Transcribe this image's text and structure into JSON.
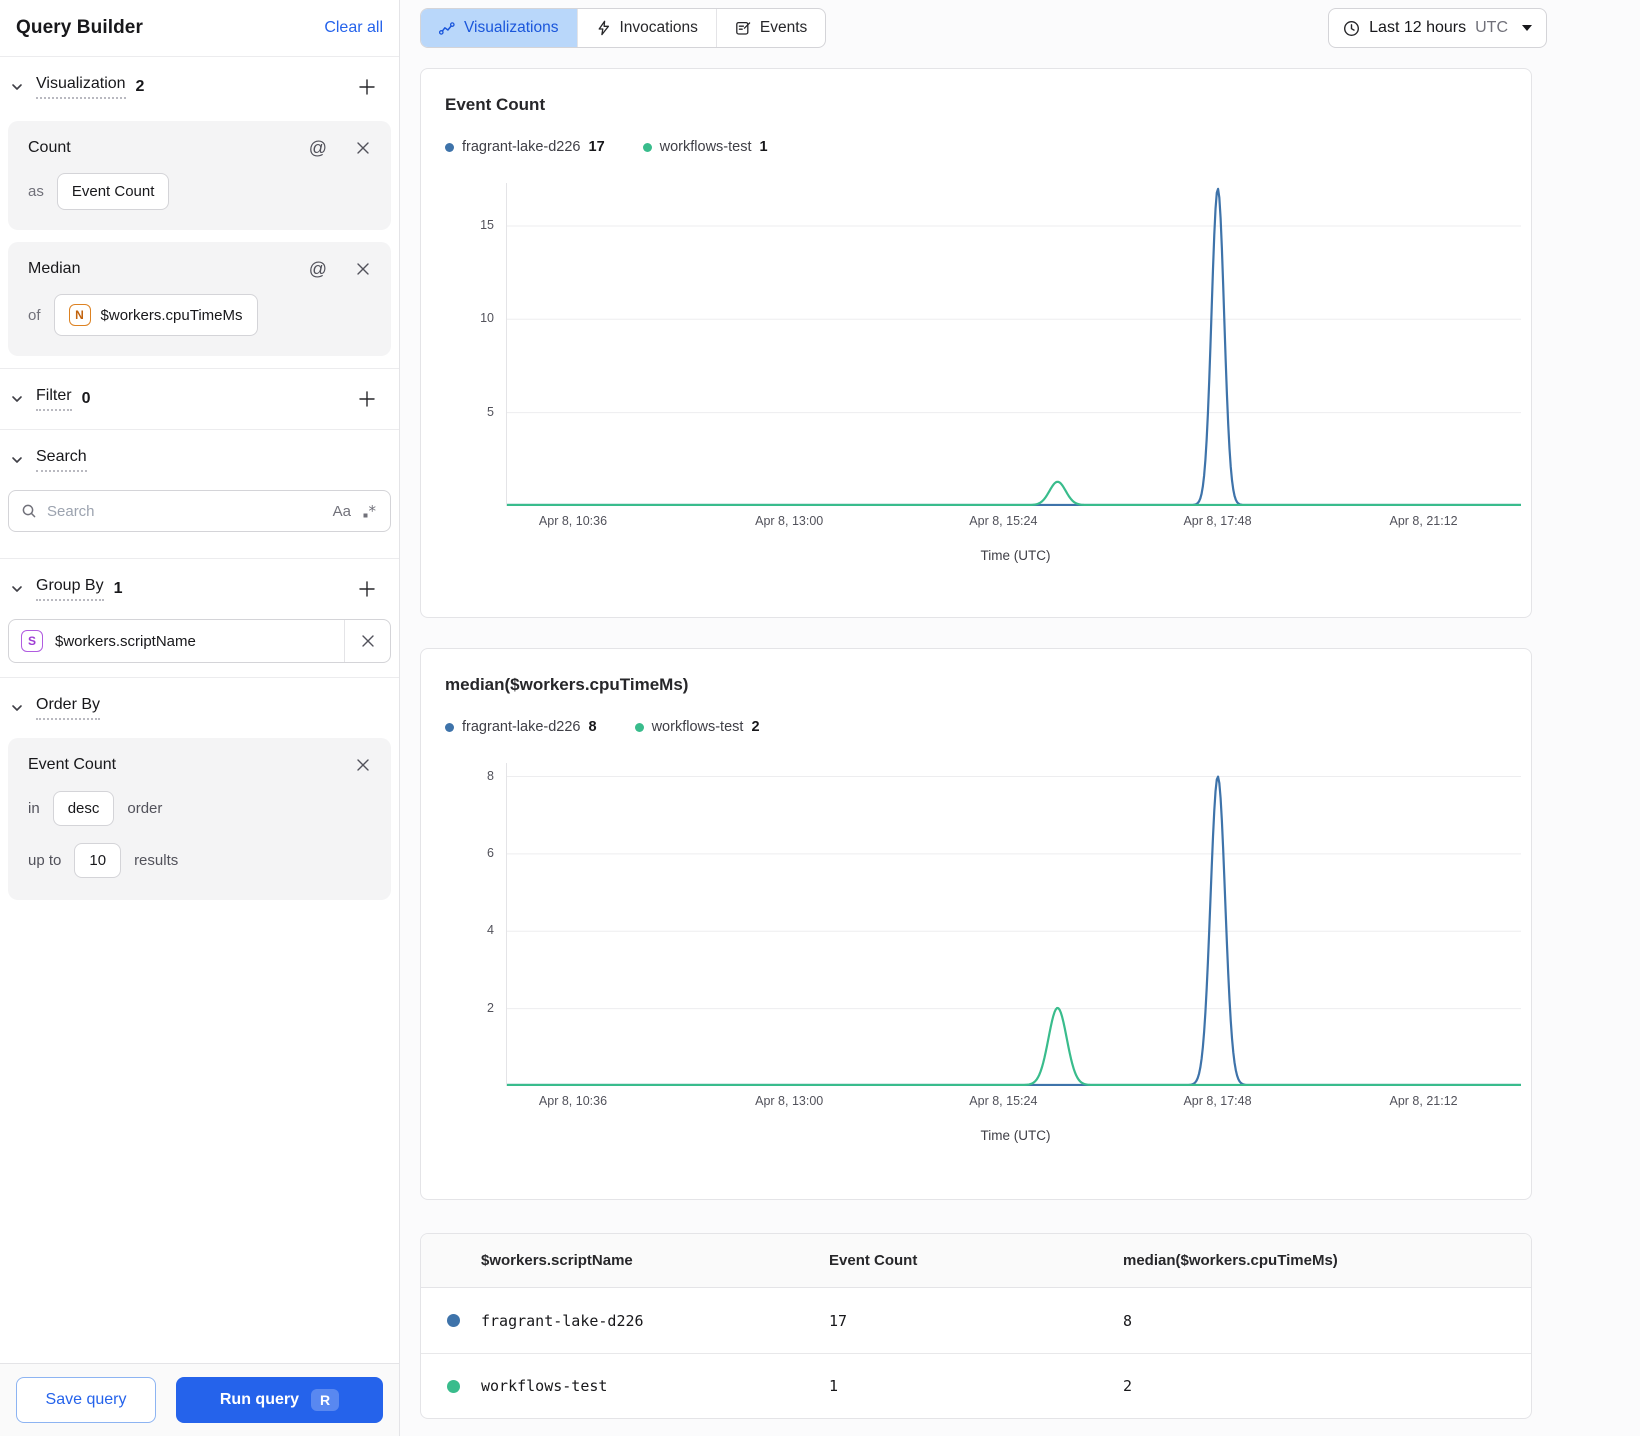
{
  "colors": {
    "accent_blue": "#2563eb",
    "tab_active_bg": "#b9d7fa",
    "tab_active_text": "#1a56db",
    "series_blue": "#3e73aa",
    "series_green": "#39bc8c"
  },
  "icons": {
    "at": "@",
    "match_case": "Aa",
    "run_shortcut": "R"
  },
  "sidebar": {
    "title": "Query Builder",
    "clear_all": "Clear all",
    "visualization_section": {
      "label": "Visualization",
      "count": "2"
    },
    "agg_cards": [
      {
        "title": "Count",
        "connector": "as",
        "value": "Event Count"
      },
      {
        "title": "Median",
        "connector": "of",
        "badge_letter": "N",
        "value": "$workers.cpuTimeMs"
      }
    ],
    "filter_section": {
      "label": "Filter",
      "count": "0"
    },
    "search_section": {
      "label": "Search",
      "placeholder": "Search"
    },
    "group_by_section": {
      "label": "Group By",
      "count": "1",
      "chip": {
        "badge_letter": "S",
        "label": "$workers.scriptName"
      }
    },
    "order_by_section": {
      "label": "Order By",
      "card": {
        "field": "Event Count",
        "in_word": "in",
        "direction": "desc",
        "order_word": "order",
        "up_to_word": "up to",
        "limit": "10",
        "results_word": "results"
      }
    },
    "footer": {
      "save": "Save query",
      "run": "Run query",
      "shortcut": "R"
    }
  },
  "topbar": {
    "tabs": [
      {
        "label": "Visualizations",
        "active": true
      },
      {
        "label": "Invocations",
        "active": false
      },
      {
        "label": "Events",
        "active": false
      }
    ],
    "time": {
      "label": "Last 12 hours",
      "tz": "UTC"
    }
  },
  "chart_data": [
    {
      "type": "line",
      "title": "Event Count",
      "xlabel": "Time (UTC)",
      "ylim": [
        0,
        17.3
      ],
      "yticks": [
        5,
        10,
        15
      ],
      "grid": true,
      "legend_position": "top",
      "x_ticks": [
        {
          "label": "Apr 8, 10:36",
          "pos": 0.066
        },
        {
          "label": "Apr 8, 13:00",
          "pos": 0.279
        },
        {
          "label": "Apr 8, 15:24",
          "pos": 0.49
        },
        {
          "label": "Apr 8, 17:48",
          "pos": 0.701
        },
        {
          "label": "Apr 8, 21:12",
          "pos": 0.904
        }
      ],
      "legend": [
        {
          "name": "fragrant-lake-d226",
          "value": "17",
          "color": "#3e73aa"
        },
        {
          "name": "workflows-test",
          "value": "1",
          "color": "#39bc8c"
        }
      ],
      "series": [
        {
          "name": "fragrant-lake-d226",
          "color": "#3e73aa",
          "baseline": 0,
          "spikes": [
            {
              "pos": 0.701,
              "near_tick": "Apr 8, 17:48",
              "peak": 17,
              "sigma": 0.0062
            }
          ]
        },
        {
          "name": "workflows-test",
          "color": "#39bc8c",
          "baseline": 0,
          "spikes": [
            {
              "pos": 0.543,
              "near_tick": "Apr 8, 15:24",
              "peak": 1.25,
              "sigma": 0.008
            }
          ]
        }
      ]
    },
    {
      "type": "line",
      "title": "median($workers.cpuTimeMs)",
      "xlabel": "Time (UTC)",
      "ylim": [
        0,
        8.35
      ],
      "yticks": [
        2,
        4,
        6,
        8
      ],
      "grid": true,
      "legend_position": "top",
      "x_ticks": [
        {
          "label": "Apr 8, 10:36",
          "pos": 0.066
        },
        {
          "label": "Apr 8, 13:00",
          "pos": 0.279
        },
        {
          "label": "Apr 8, 15:24",
          "pos": 0.49
        },
        {
          "label": "Apr 8, 17:48",
          "pos": 0.701
        },
        {
          "label": "Apr 8, 21:12",
          "pos": 0.904
        }
      ],
      "legend": [
        {
          "name": "fragrant-lake-d226",
          "value": "8",
          "color": "#3e73aa"
        },
        {
          "name": "workflows-test",
          "value": "2",
          "color": "#39bc8c"
        }
      ],
      "series": [
        {
          "name": "fragrant-lake-d226",
          "color": "#3e73aa",
          "baseline": 0,
          "spikes": [
            {
              "pos": 0.701,
              "near_tick": "Apr 8, 17:48",
              "peak": 8,
              "sigma": 0.0072
            }
          ]
        },
        {
          "name": "workflows-test",
          "color": "#39bc8c",
          "baseline": 0,
          "spikes": [
            {
              "pos": 0.543,
              "near_tick": "Apr 8, 15:24",
              "peak": 2,
              "sigma": 0.009
            }
          ]
        }
      ]
    }
  ],
  "table": {
    "columns": [
      "$workers.scriptName",
      "Event Count",
      "median($workers.cpuTimeMs)"
    ],
    "rows": [
      {
        "color": "#3e73aa",
        "name": "fragrant-lake-d226",
        "event_count": "17",
        "median": "8"
      },
      {
        "color": "#39bc8c",
        "name": "workflows-test",
        "event_count": "1",
        "median": "2"
      }
    ]
  }
}
